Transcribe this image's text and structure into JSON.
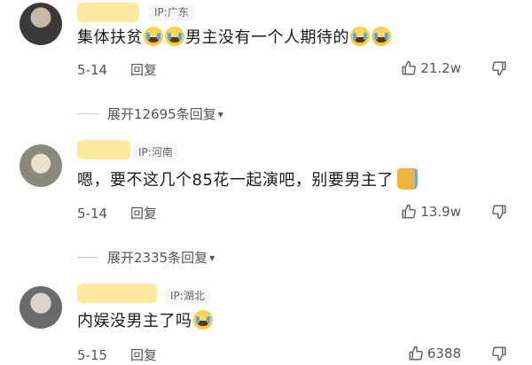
{
  "comments": [
    {
      "ip": "IP:广东",
      "text_part1": "集体扶贫",
      "text_part2": "男主没有一个人期待的",
      "date": "5-14",
      "reply": "回复",
      "likes": "21.2w",
      "expand": "展开12695条回复"
    },
    {
      "ip": "IP:河南",
      "text": "嗯，要不这几个85花一起演吧，别要男主了",
      "date": "5-14",
      "reply": "回复",
      "likes": "13.9w",
      "expand": "展开2335条回复"
    },
    {
      "ip": "IP:湖北",
      "text": "内娱没男主了吗",
      "date": "5-15",
      "reply": "回复",
      "likes": "6388"
    }
  ]
}
